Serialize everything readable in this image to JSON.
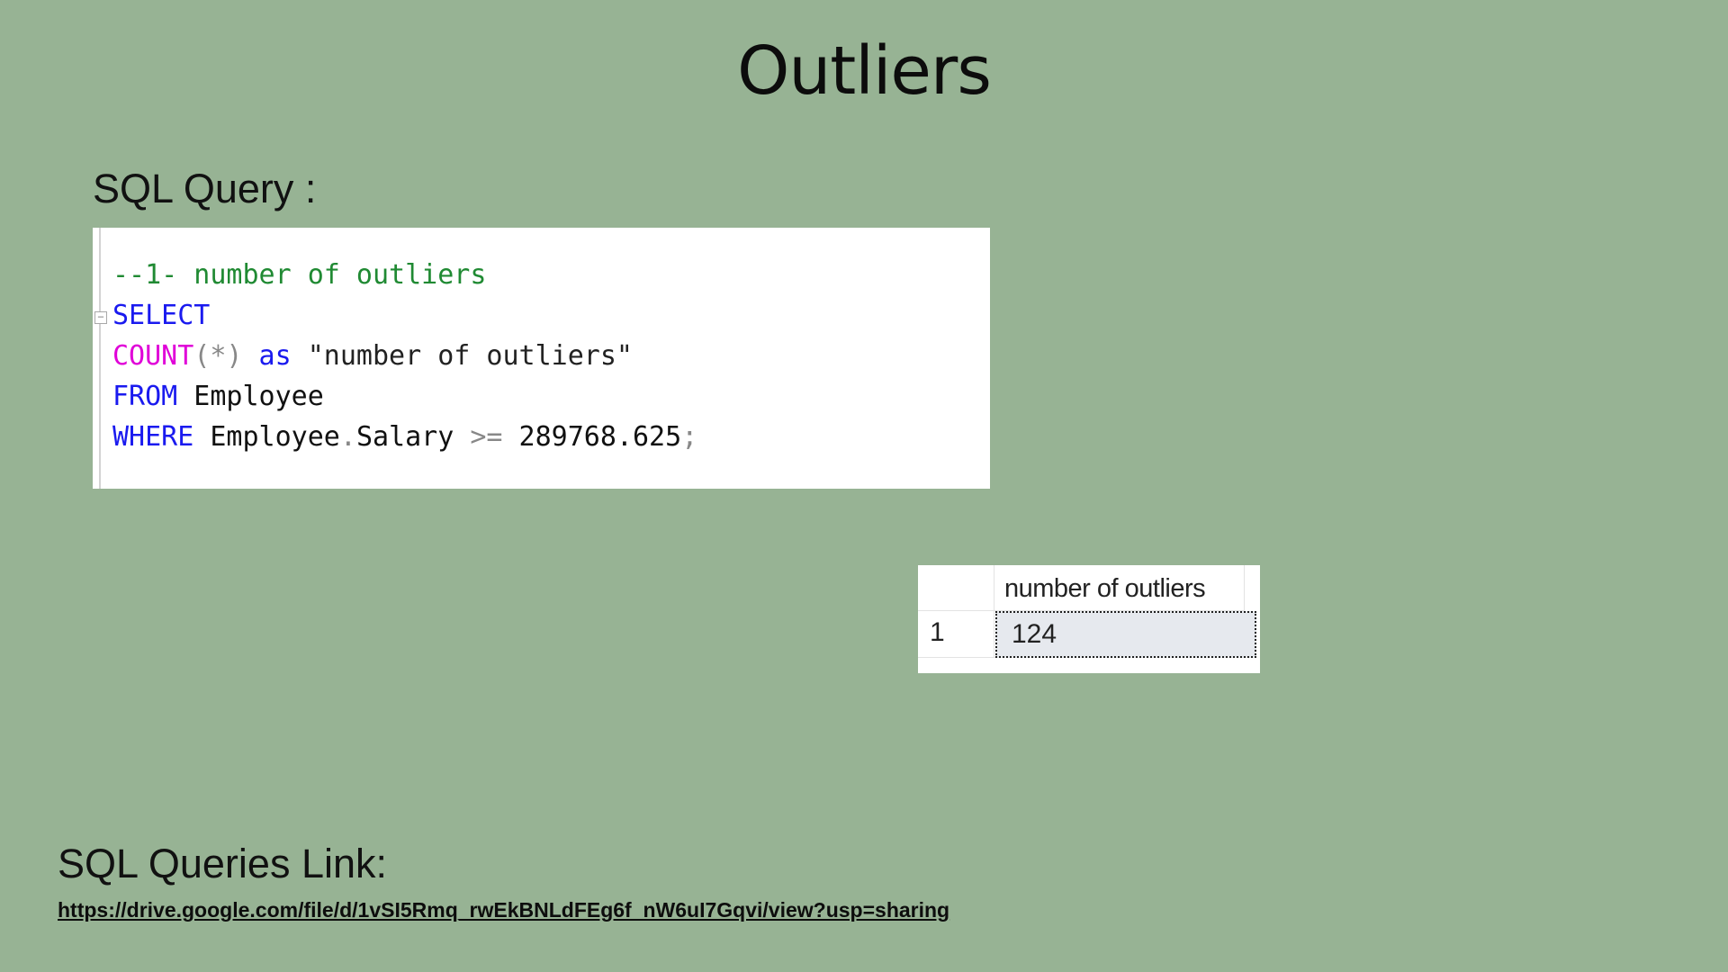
{
  "slide": {
    "title": "Outliers"
  },
  "sql_section": {
    "heading": "SQL Query :"
  },
  "code": {
    "lines": [
      [
        {
          "t": "--1- number of outliers",
          "c": "comment"
        }
      ],
      [
        {
          "t": "SELECT",
          "c": "keyword"
        }
      ],
      [
        {
          "t": "COUNT",
          "c": "func"
        },
        {
          "t": "(*)",
          "c": "punct"
        },
        {
          "t": " as ",
          "c": "keyword"
        },
        {
          "t": "\"number of outliers\"",
          "c": "string"
        }
      ],
      [
        {
          "t": "FROM",
          "c": "keyword"
        },
        {
          "t": " Employee",
          "c": "ident"
        }
      ],
      [
        {
          "t": "WHERE",
          "c": "keyword"
        },
        {
          "t": " Employee",
          "c": "ident"
        },
        {
          "t": ".",
          "c": "punct"
        },
        {
          "t": "Salary ",
          "c": "ident"
        },
        {
          "t": ">=",
          "c": "op"
        },
        {
          "t": " 289768.625",
          "c": "num"
        },
        {
          "t": ";",
          "c": "punct"
        }
      ]
    ],
    "colors": {
      "comment": "#208a33",
      "keyword": "#1a1aef",
      "func": "#e000d8",
      "punct": "#888888"
    }
  },
  "results": {
    "column_header": "number of outliers",
    "row_number": "1",
    "value": "124"
  },
  "links_section": {
    "heading": "SQL Queries Link:",
    "url": "https://drive.google.com/file/d/1vSI5Rmq_rwEkBNLdFEg6f_nW6uI7Gqvi/view?usp=sharing"
  },
  "colors": {
    "background": "#97b394",
    "panel": "#ffffff"
  }
}
